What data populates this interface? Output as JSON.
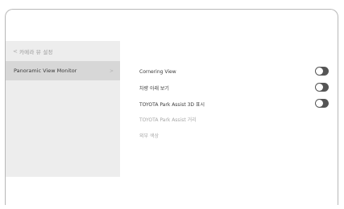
{
  "sidebar": {
    "back_label": "<",
    "header_title": "카메라 뷰 설정",
    "items": [
      {
        "label": "Panoramic View Monitor",
        "chevron": ">"
      }
    ]
  },
  "settings": [
    {
      "label": "Cornering View",
      "toggle": "on"
    },
    {
      "label": "차량 아래 보기",
      "toggle": "on"
    },
    {
      "label": "TOYOTA Park Assist 3D 표시",
      "toggle": "on"
    },
    {
      "label": "TOYOTA Park Assist 거리",
      "toggle": "disabled"
    },
    {
      "label": "외부 색상",
      "toggle": "disabled"
    }
  ],
  "colors": {
    "sidebar_bg": "#ededed",
    "selected_bg": "#d7d7d7",
    "toggle_on": "#555555",
    "disabled_text": "#a6a6a6"
  }
}
